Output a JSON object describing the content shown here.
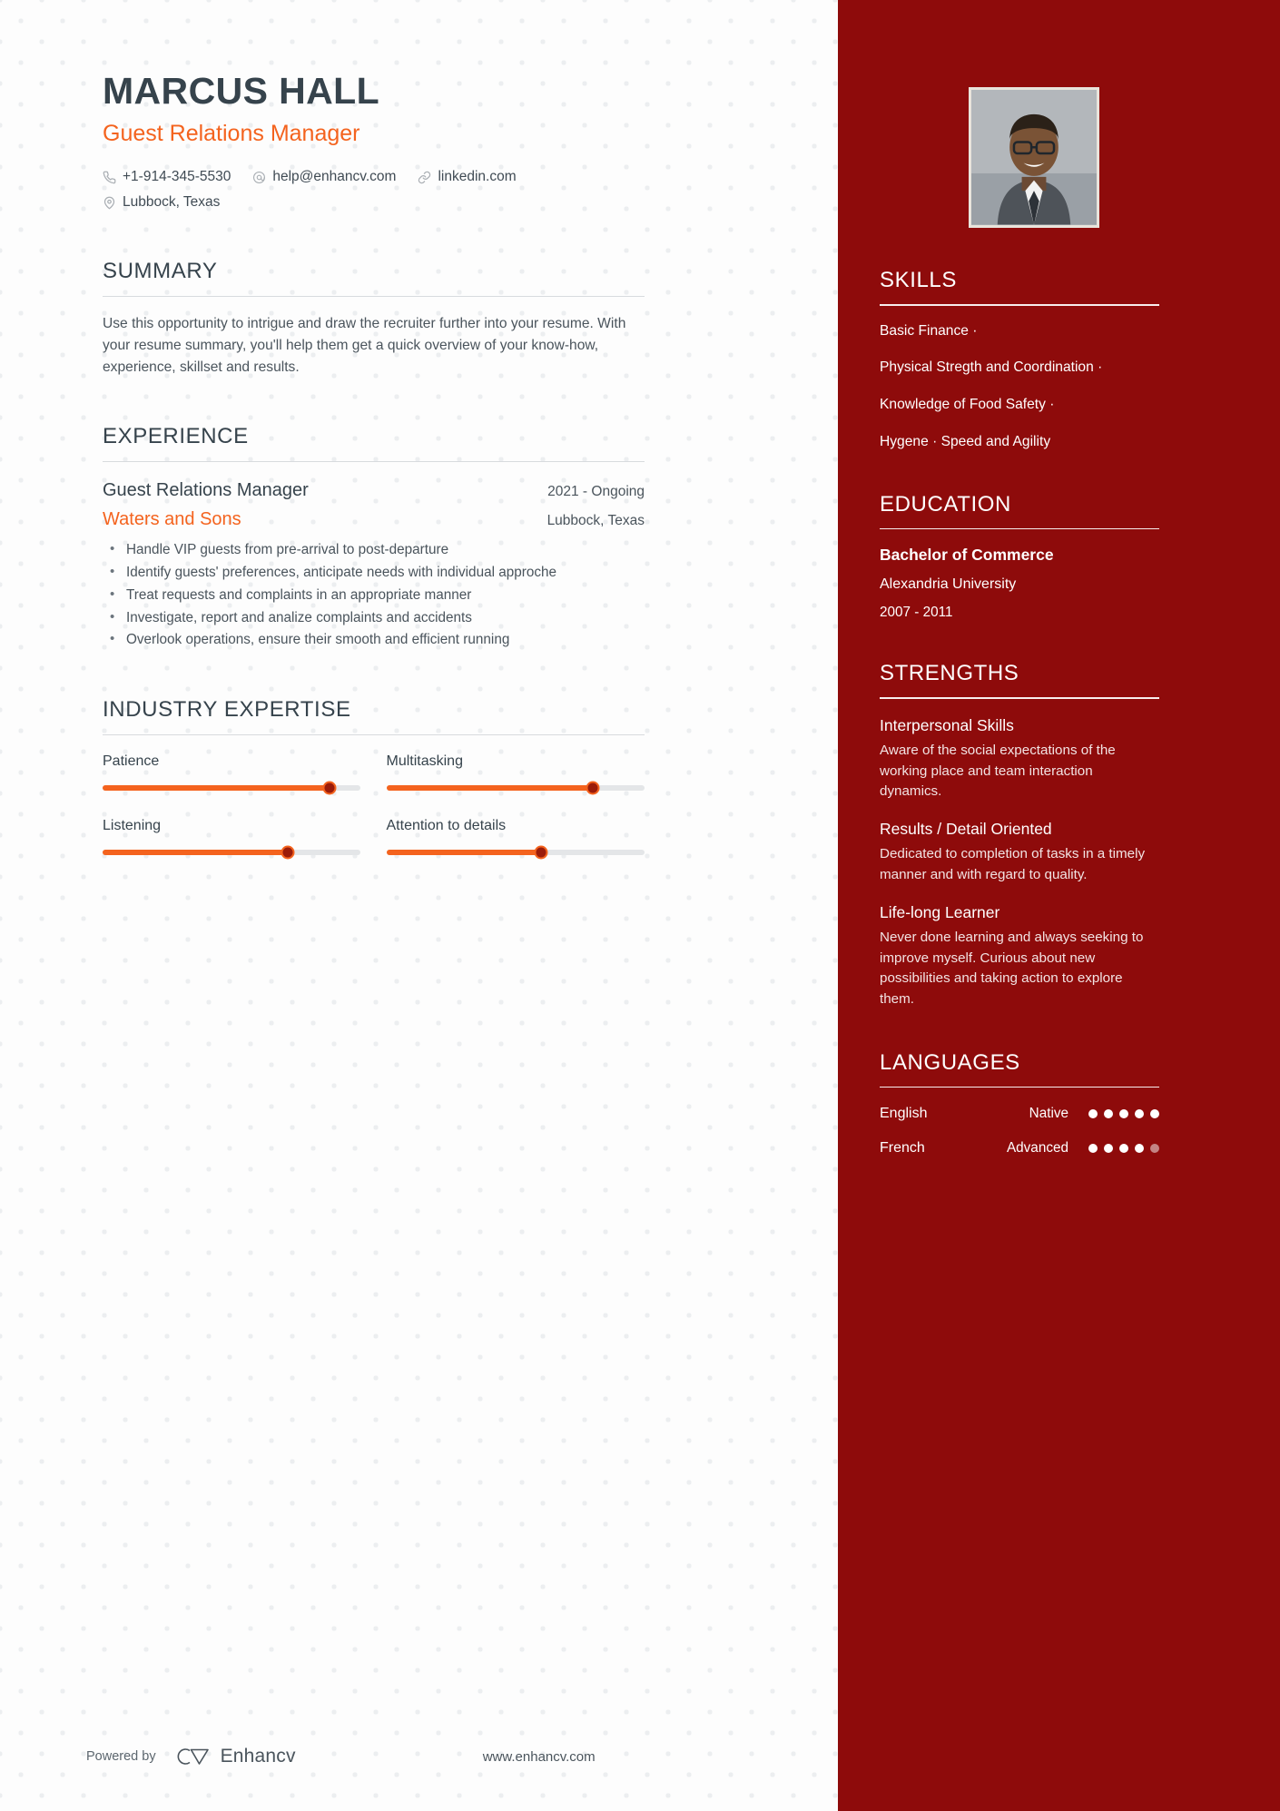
{
  "header": {
    "name": "MARCUS HALL",
    "job_title": "Guest Relations Manager",
    "contacts": [
      {
        "icon": "phone-icon",
        "text": "+1-914-345-5530"
      },
      {
        "icon": "email-icon",
        "text": "help@enhancv.com"
      },
      {
        "icon": "link-icon",
        "text": "linkedin.com"
      },
      {
        "icon": "location-icon",
        "text": "Lubbock, Texas"
      }
    ]
  },
  "summary": {
    "title": "SUMMARY",
    "text": "Use this opportunity to intrigue and draw the recruiter further into your resume. With your resume summary, you'll help them get a quick overview of your know-how, experience, skillset and results."
  },
  "experience": {
    "title": "EXPERIENCE",
    "role": "Guest Relations Manager",
    "dates": "2021 - Ongoing",
    "company": "Waters and Sons",
    "location": "Lubbock, Texas",
    "bullets": [
      "Handle VIP guests from pre-arrival to post-departure",
      "Identify guests' preferences, anticipate needs with individual approche",
      "Treat requests and complaints in an appropriate manner",
      "Investigate, report and analize complaints and accidents",
      "Overlook operations, ensure their smooth and efficient running"
    ]
  },
  "industry_expertise": {
    "title": "INDUSTRY EXPERTISE",
    "items": [
      {
        "label": "Patience",
        "percent": 88
      },
      {
        "label": "Multitasking",
        "percent": 80
      },
      {
        "label": "Listening",
        "percent": 72
      },
      {
        "label": "Attention to details",
        "percent": 60
      }
    ]
  },
  "skills": {
    "title": "SKILLS",
    "lines": [
      "Basic Finance ·",
      "Physical Stregth and Coordination ·",
      "Knowledge of Food Safety ·",
      "Hygene · Speed and Agility"
    ]
  },
  "education": {
    "title": "EDUCATION",
    "degree": "Bachelor of Commerce",
    "school": "Alexandria University",
    "years": "2007 - 2011"
  },
  "strengths": {
    "title": "STRENGTHS",
    "items": [
      {
        "name": "Interpersonal Skills",
        "desc": "Aware of the social expectations of the working place and team interaction dynamics."
      },
      {
        "name": "Results / Detail Oriented",
        "desc": "Dedicated to completion of tasks in a timely manner and with regard to quality."
      },
      {
        "name": "Life-long Learner",
        "desc": "Never done learning and always seeking to improve myself. Curious about new possibilities and taking action to explore them."
      }
    ]
  },
  "languages": {
    "title": "LANGUAGES",
    "items": [
      {
        "name": "English",
        "level": "Native",
        "filled": 5,
        "total": 5
      },
      {
        "name": "French",
        "level": "Advanced",
        "filled": 4,
        "total": 5
      }
    ]
  },
  "footer": {
    "powered_by": "Powered by",
    "brand": "Enhancv",
    "url": "www.enhancv.com"
  },
  "colors": {
    "sidebar": "#8e0b0b",
    "accent": "#f4631e",
    "heading": "#36434c",
    "body": "#4a545c"
  }
}
